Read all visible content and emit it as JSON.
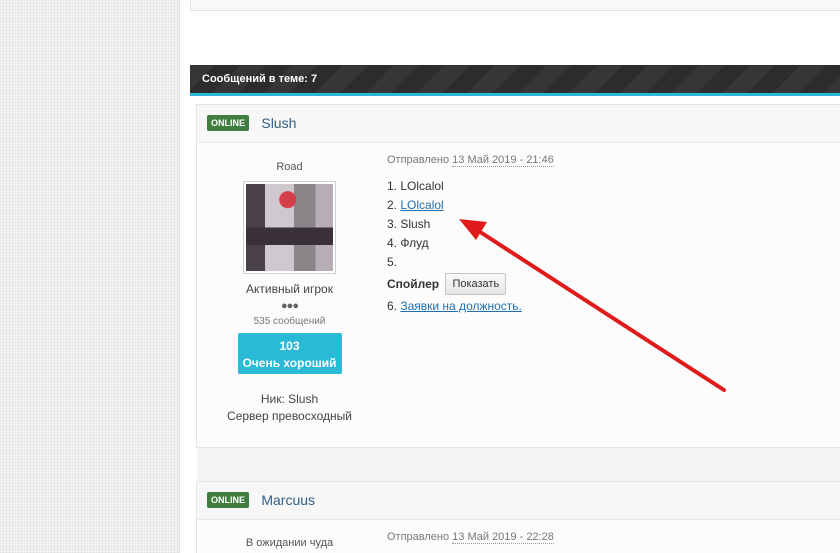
{
  "topic": {
    "header_text": "Сообщений в теме: 7"
  },
  "posts": [
    {
      "status": "ONLINE",
      "author": "Slush",
      "rank_title": "Road",
      "group": "Активный игрок",
      "pips": "●●●",
      "post_count": "535 сообщений",
      "reputation_value": "103",
      "reputation_label": "Очень хороший",
      "nick_line": "Ник: Slush",
      "server_line": "Сервер превосходный",
      "posted_prefix": "Отправлено",
      "posted_date": "13 Май 2019 - 21:46",
      "lines": {
        "l1": "1. LOlcalol",
        "l2_prefix": "2. ",
        "l2_link": "LOlcalol",
        "l3": "3. Slush",
        "l4": "4. Флуд",
        "l5": "5.",
        "spoiler_label": "Спойлер",
        "spoiler_button": "Показать",
        "l6_prefix": "6. ",
        "l6_link": "Заявки на должность."
      }
    },
    {
      "status": "ONLINE",
      "author": "Marcuus",
      "rank_title": "В ожидании чуда",
      "posted_prefix": "Отправлено",
      "posted_date": "13 Май 2019 - 22:28"
    }
  ],
  "annotation": {
    "arrow_color": "#e01b1b"
  },
  "colors": {
    "accent": "#2ab8d4",
    "online": "#3f7e3f",
    "link": "#1f6fae"
  }
}
